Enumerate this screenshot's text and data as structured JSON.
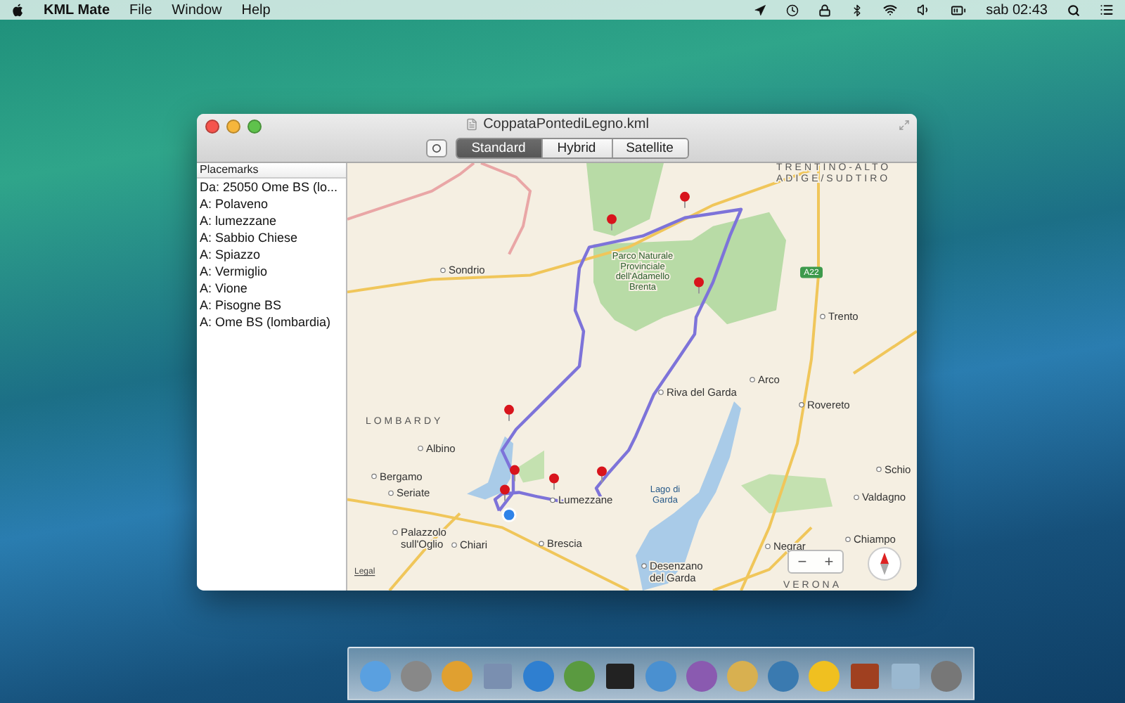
{
  "menu_bar": {
    "app_name": "KML Mate",
    "menus": [
      "File",
      "Window",
      "Help"
    ],
    "clock": "sab 02:43"
  },
  "window": {
    "title": "CoppataPontediLegno.kml",
    "map_types": [
      {
        "label": "Standard",
        "selected": true
      },
      {
        "label": "Hybrid",
        "selected": false
      },
      {
        "label": "Satellite",
        "selected": false
      }
    ]
  },
  "sidebar": {
    "header": "Placemarks",
    "items": [
      "Da: 25050 Ome BS (lo...",
      "A: Polaveno",
      "A: lumezzane",
      "A: Sabbio Chiese",
      "A: Spiazzo",
      "A: Vermiglio",
      "A: Vione",
      "A: Pisogne BS",
      "A: Ome BS (lombardia)"
    ]
  },
  "map": {
    "labels": [
      {
        "kind": "region",
        "lines": [
          "TRENTINO-ALTO",
          "ADIGE/SUDTIRO"
        ]
      },
      {
        "kind": "city",
        "lines": [
          "Sondrio"
        ]
      },
      {
        "kind": "park",
        "lines": [
          "Parco Naturale",
          "Provinciale",
          "dell'Adamello",
          "Brenta"
        ]
      },
      {
        "kind": "highway",
        "lines": [
          "A22"
        ]
      },
      {
        "kind": "city",
        "lines": [
          "Trento"
        ]
      },
      {
        "kind": "city",
        "lines": [
          "Arco"
        ]
      },
      {
        "kind": "city",
        "lines": [
          "Riva del Garda"
        ]
      },
      {
        "kind": "city",
        "lines": [
          "Rovereto"
        ]
      },
      {
        "kind": "region",
        "lines": [
          "LOMBARDY"
        ]
      },
      {
        "kind": "city",
        "lines": [
          "Albino"
        ]
      },
      {
        "kind": "city",
        "lines": [
          "Bergamo"
        ]
      },
      {
        "kind": "city",
        "lines": [
          "Seriate"
        ]
      },
      {
        "kind": "city",
        "lines": [
          "Palazzolo",
          "sull'Oglio"
        ]
      },
      {
        "kind": "city",
        "lines": [
          "Chiari"
        ]
      },
      {
        "kind": "city",
        "lines": [
          "Brescia"
        ]
      },
      {
        "kind": "city",
        "lines": [
          "Lumezzane"
        ]
      },
      {
        "kind": "water",
        "lines": [
          "Lago di",
          "Garda"
        ]
      },
      {
        "kind": "city",
        "lines": [
          "Desenzano",
          "del Garda"
        ]
      },
      {
        "kind": "city",
        "lines": [
          "Negrar"
        ]
      },
      {
        "kind": "city",
        "lines": [
          "Schio"
        ]
      },
      {
        "kind": "city",
        "lines": [
          "Valdagno"
        ]
      },
      {
        "kind": "city",
        "lines": [
          "Chiampo"
        ]
      },
      {
        "kind": "region",
        "lines": [
          "VERONA"
        ]
      }
    ],
    "legal": "Legal",
    "zoom_out": "−",
    "zoom_in": "+"
  }
}
